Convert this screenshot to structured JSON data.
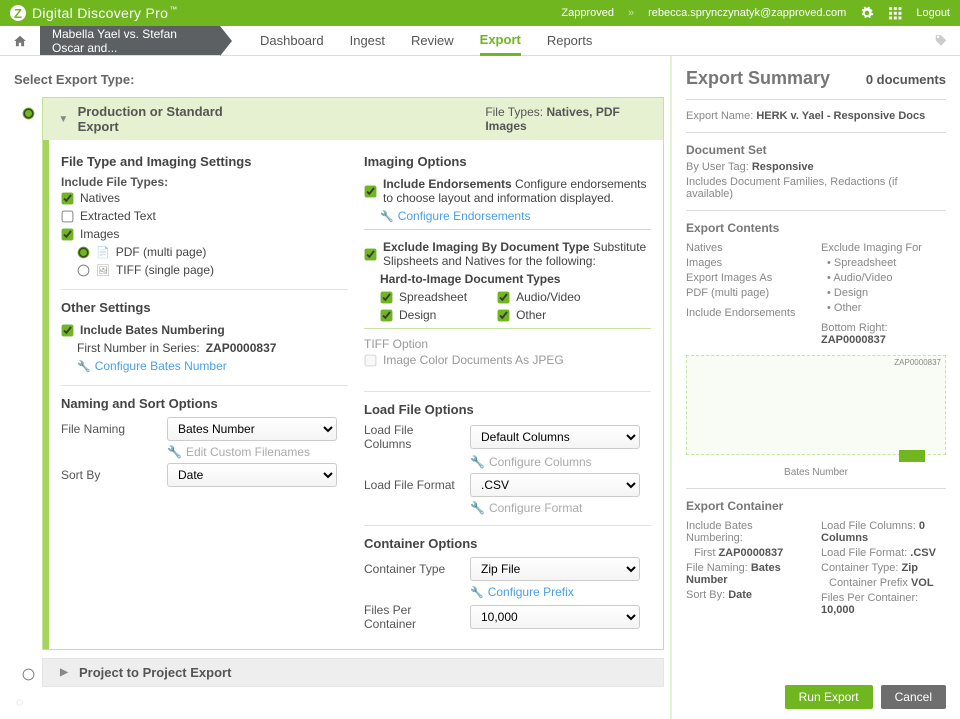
{
  "header": {
    "product": "Digital Discovery Pro",
    "tm": "™",
    "org": "Zapproved",
    "user_email": "rebecca.sprynczynatyk@zapproved.com",
    "logout": "Logout"
  },
  "subbar": {
    "case_title": "Mabella Yael vs. Stefan Oscar and...",
    "tabs": {
      "dashboard": "Dashboard",
      "ingest": "Ingest",
      "review": "Review",
      "export": "Export",
      "reports": "Reports"
    }
  },
  "select_title": "Select Export Type:",
  "option1": {
    "title": "Production or Standard Export",
    "ft_label": "File Types:",
    "ft_value": "Natives, PDF Images",
    "settings": {
      "heading": "File Type and Imaging Settings",
      "include_label": "Include File Types:",
      "natives": "Natives",
      "extracted_text": "Extracted Text",
      "images": "Images",
      "pdf_multi": "PDF (multi page)",
      "tiff_single": "TIFF (single page)"
    },
    "imaging": {
      "heading": "Imaging Options",
      "include_endorsements": "Include Endorsements",
      "include_end_desc": "Configure endorsements to choose layout and information displayed.",
      "configure_endorsements": "Configure Endorsements",
      "exclude_label": "Exclude Imaging By Document Type",
      "exclude_desc": "Substitute Slipsheets and Natives for the following:",
      "hard_label": "Hard-to-Image Document Types",
      "spreadsheet": "Spreadsheet",
      "audio_video": "Audio/Video",
      "design": "Design",
      "other": "Other",
      "tiff_option_hd": "TIFF Option",
      "image_color_jpeg": "Image Color Documents As JPEG"
    },
    "other_settings": {
      "heading": "Other Settings",
      "include_bates": "Include Bates Numbering",
      "first_number_line": "First Number in Series: ",
      "first_number_value": "ZAP0000837",
      "configure_bates": "Configure Bates Number"
    },
    "loadfile": {
      "heading": "Load File Options",
      "columns_label": "Load File Columns",
      "columns_value": "Default Columns",
      "configure_columns": "Configure Columns",
      "format_label": "Load File Format",
      "format_value": ".CSV",
      "configure_format": "Configure Format"
    },
    "naming": {
      "heading": "Naming and Sort Options",
      "file_naming_label": "File Naming",
      "file_naming_value": "Bates Number",
      "edit_custom": "Edit Custom Filenames",
      "sort_by_label": "Sort By",
      "sort_by_value": "Date"
    },
    "container": {
      "heading": "Container Options",
      "type_label": "Container Type",
      "type_value": "Zip File",
      "configure_prefix": "Configure Prefix",
      "files_per_label": "Files Per Container",
      "files_per_value": "10,000"
    }
  },
  "option2": {
    "title": "Project to Project Export"
  },
  "summary": {
    "title": "Export Summary",
    "doc_count": "0 documents",
    "export_name_label": "Export Name:",
    "export_name_value": "HERK v. Yael - Responsive Docs",
    "doc_set_hd": "Document Set",
    "by_user_tag_label": "By User Tag:",
    "by_user_tag_value": "Responsive",
    "includes_line": "Includes Document Families, Redactions (if available)",
    "contents_hd": "Export Contents",
    "contents_left": {
      "l1": "Natives",
      "l2": "Images",
      "l3": "Export Images As",
      "l4": "PDF (multi page)",
      "l5": "Include Endorsements"
    },
    "contents_right_hd": "Exclude Imaging For",
    "contents_right": {
      "b1": "Spreadsheet",
      "b2": "Audio/Video",
      "b3": "Design",
      "b4": "Other"
    },
    "bottom_right_label": "Bottom Right:",
    "bottom_right_value": "ZAP0000837",
    "caption": "Bates Number",
    "container_hd": "Export Container",
    "container_left": {
      "l1": "Include Bates Numbering:",
      "l1v_label": "First",
      "l1v": "ZAP0000837",
      "l2": "File Naming:",
      "l2v": "Bates Number",
      "l3": "Sort By:",
      "l3v": "Date"
    },
    "container_right": {
      "r1": "Load File Columns:",
      "r1v": "0 Columns",
      "r2": "Load File Format:",
      "r2v": ".CSV",
      "r3": "Container Type:",
      "r3v": "Zip",
      "r3b_label": "Container Prefix",
      "r3b": "VOL",
      "r4": "Files Per Container:",
      "r4v": "10,000"
    },
    "run_btn": "Run Export",
    "cancel_btn": "Cancel"
  }
}
